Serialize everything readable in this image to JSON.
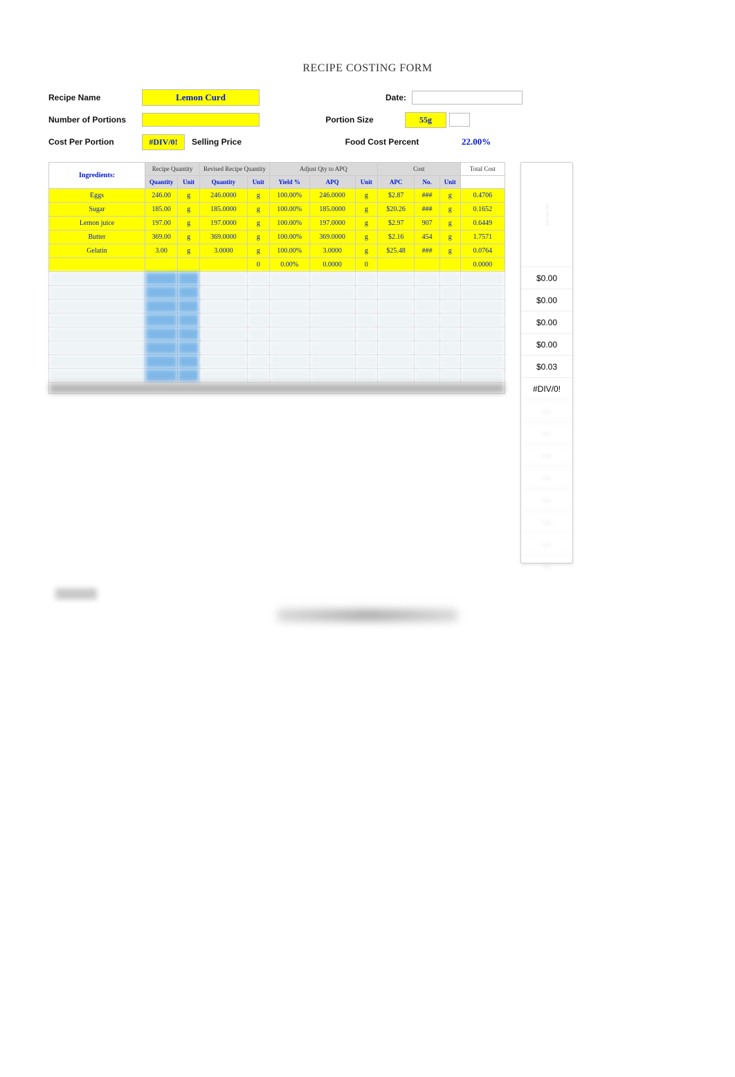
{
  "title": "RECIPE COSTING FORM",
  "header": {
    "recipe_name_label": "Recipe Name",
    "recipe_name_value": "Lemon Curd",
    "date_label": "Date:",
    "num_portions_label": "Number of Portions",
    "portion_size_label": "Portion Size",
    "portion_size_value": "55g",
    "cost_per_portion_label": "Cost Per Portion",
    "cost_per_portion_value": "#DIV/0!",
    "selling_price_label": "Selling Price",
    "food_cost_percent_label": "Food Cost Percent",
    "food_cost_percent_value": "22.00%"
  },
  "group_headers": {
    "recipe_qty": "Recipe Quantity",
    "revised_qty": "Revised Recipe Quantity",
    "adjust_apq": "Adjust Qty to APQ",
    "cost": "Cost",
    "total_cost": "Total Cost"
  },
  "col_headers": {
    "ingredients": "Ingredients:",
    "quantity": "Quantity",
    "unit": "Unit",
    "yield": "Yield %",
    "apq": "APQ",
    "apc": "APC",
    "no": "No."
  },
  "rows": [
    {
      "name": "Eggs",
      "qty": "246.00",
      "unit": "g",
      "rqty": "246.0000",
      "runit": "g",
      "yield": "100.00%",
      "apq": "246.0000",
      "apqunit": "g",
      "apc": "$2.87",
      "no": "###",
      "cunit": "g",
      "tcost": "0.4706",
      "side": "$0.00"
    },
    {
      "name": " Sugar",
      "qty": "185.00",
      "unit": "g",
      "rqty": "185.0000",
      "runit": "g",
      "yield": "100.00%",
      "apq": "185.0000",
      "apqunit": "g",
      "apc": "$20.26",
      "no": "###",
      "cunit": "g",
      "tcost": "0.1652",
      "side": "$0.00"
    },
    {
      "name": "Lemon juice",
      "qty": "197.00",
      "unit": "g",
      "rqty": "197.0000",
      "runit": "g",
      "yield": "100.00%",
      "apq": "197.0000",
      "apqunit": "g",
      "apc": "$2.97",
      "no": "907",
      "cunit": "g",
      "tcost": "0.6449",
      "side": "$0.00"
    },
    {
      "name": "Butter",
      "qty": "369.00",
      "unit": "g",
      "rqty": "369.0000",
      "runit": "g",
      "yield": "100.00%",
      "apq": "369.0000",
      "apqunit": "g",
      "apc": "$2.16",
      "no": "454",
      "cunit": "g",
      "tcost": "1.7571",
      "side": "$0.00"
    },
    {
      "name": "Gelatin",
      "qty": "3.00",
      "unit": "g",
      "rqty": "3.0000",
      "runit": "g",
      "yield": "100.00%",
      "apq": "3.0000",
      "apqunit": "g",
      "apc": "$25.48",
      "no": "###",
      "cunit": "g",
      "tcost": "0.0764",
      "side": "$0.03"
    },
    {
      "name": "",
      "qty": "",
      "unit": "",
      "rqty": "",
      "runit": "0",
      "yield": "0.00%",
      "apq": "0.0000",
      "apqunit": "0",
      "apc": "",
      "no": "",
      "cunit": "",
      "tcost": "0.0000",
      "side": "#DIV/0!"
    }
  ],
  "blur_row_count": 8,
  "side_blur_count": 8
}
